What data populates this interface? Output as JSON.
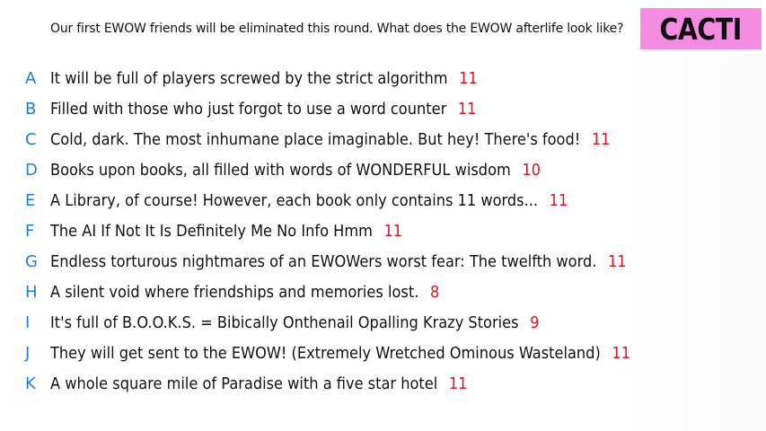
{
  "prompt": "Our first EWOW friends will be eliminated this round. What does the EWOW afterlife look like?",
  "badge": "CACTI",
  "colors": {
    "letter": "#1f7fd6",
    "count": "#e0141e",
    "badge_bg": "#f48de2"
  },
  "answers": [
    {
      "letter": "A",
      "text": "It will be full of players screwed by the strict algorithm",
      "count": "11"
    },
    {
      "letter": "B",
      "text": "Filled with those who just forgot to use a word counter",
      "count": "11"
    },
    {
      "letter": "C",
      "text": "Cold, dark. The most inhumane place imaginable. But hey! There's food!",
      "count": "11"
    },
    {
      "letter": "D",
      "text": "Books upon books, all filled with words of WONDERFUL wisdom",
      "count": "10"
    },
    {
      "letter": "E",
      "text": "A Library, of course! However, each book only contains 11 words...",
      "count": "11"
    },
    {
      "letter": "F",
      "text": "The AI If Not It Is Definitely Me No Info Hmm",
      "count": "11"
    },
    {
      "letter": "G",
      "text": "Endless torturous nightmares of an EWOWers worst fear: The twelfth word.",
      "count": "11"
    },
    {
      "letter": "H",
      "text": "A silent void where friendships and memories lost.",
      "count": "8"
    },
    {
      "letter": "I",
      "text": "It's full of B.O.O.K.S. = Bibically Onthenail Opalling Krazy Stories",
      "count": "9"
    },
    {
      "letter": "J",
      "text": "They will get sent to the EWOW! (Extremely Wretched Ominous Wasteland)",
      "count": "11"
    },
    {
      "letter": "K",
      "text": "A whole square mile of Paradise with a five star hotel",
      "count": "11"
    }
  ]
}
